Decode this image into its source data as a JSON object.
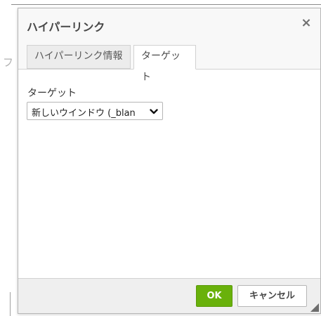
{
  "dialog": {
    "title": "ハイパーリンク",
    "close_symbol": "×"
  },
  "tabs": [
    {
      "label": "ハイパーリンク情報",
      "selected": false
    },
    {
      "label": "ターゲット",
      "selected": true
    }
  ],
  "target_field": {
    "label": "ターゲット",
    "selected_value": "新しいウインドウ (_blan"
  },
  "footer": {
    "ok_label": "OK",
    "cancel_label": "キャンセル"
  },
  "backdrop": {
    "partial_char": "フ"
  },
  "colors": {
    "ok_button": "#69b10b",
    "title_text": "#484848",
    "tab_background": "#ececec",
    "footer_background": "#efefef"
  },
  "icons": {
    "close": "close-icon",
    "dropdown": "chevron-down-icon",
    "resize": "resize-grip-icon"
  }
}
